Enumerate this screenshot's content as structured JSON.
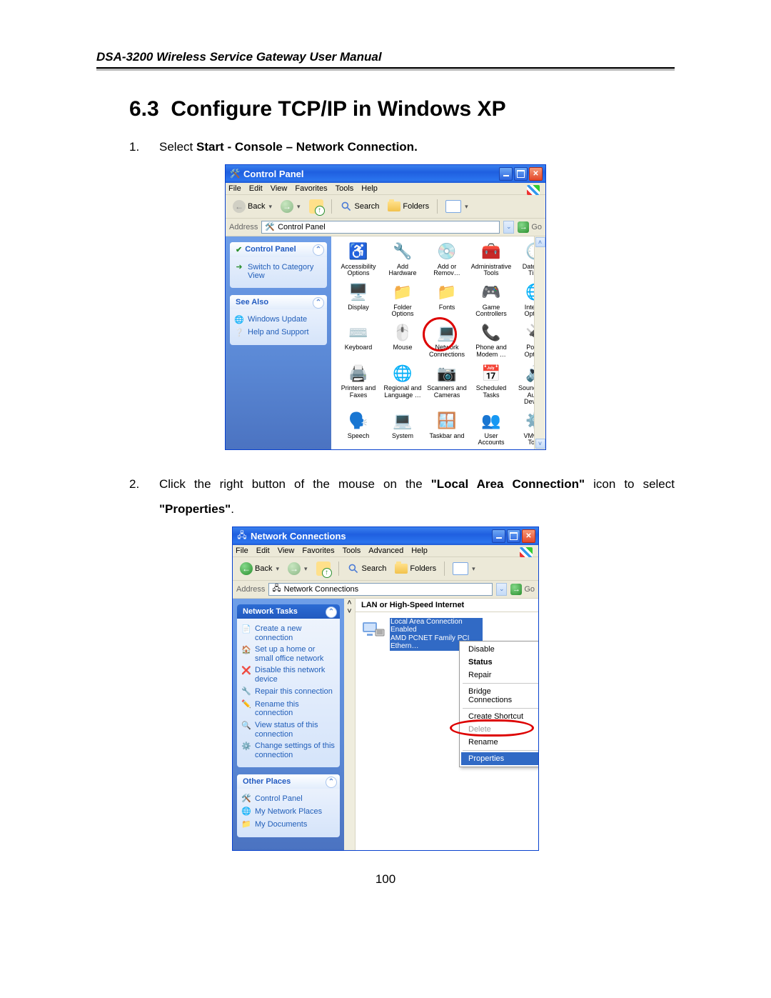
{
  "header": {
    "running_head": "DSA-3200 Wireless Service Gateway User Manual"
  },
  "section": {
    "number": "6.3",
    "title": "Configure TCP/IP in Windows XP"
  },
  "steps": {
    "s1_num": "1.",
    "s1_a": "Select ",
    "s1_b": "Start - Console – Network Connection.",
    "s2_num": "2.",
    "s2_a": "Click the right button of the mouse on the ",
    "s2_b": "\"Local Area Connection\"",
    "s2_c": " icon to select ",
    "s2_d": "\"Properties\"",
    "s2_e": "."
  },
  "win1": {
    "title": "Control Panel",
    "menus": [
      "File",
      "Edit",
      "View",
      "Favorites",
      "Tools",
      "Help"
    ],
    "back": "Back",
    "search": "Search",
    "folders": "Folders",
    "addr_label": "Address",
    "addr_value": "Control Panel",
    "go": "Go",
    "side1_head": "Control Panel",
    "side1_item": "Switch to Category View",
    "side2_head": "See Also",
    "side2_items": [
      "Windows Update",
      "Help and Support"
    ],
    "grid": [
      {
        "l": "Accessibility Options",
        "i": "♿",
        "c": "#2a8f2f"
      },
      {
        "l": "Add Hardware",
        "i": "🔧",
        "c": "#5a5a5a"
      },
      {
        "l": "Add or Remov…",
        "i": "💿",
        "c": "#4b7bd6"
      },
      {
        "l": "Administrative Tools",
        "i": "🧰",
        "c": "#caa24a"
      },
      {
        "l": "Date and Time",
        "i": "🕒",
        "c": "#4b7bd6"
      },
      {
        "l": "Display",
        "i": "🖥️",
        "c": "#4b7bd6"
      },
      {
        "l": "Folder Options",
        "i": "📁",
        "c": "#e3b84e"
      },
      {
        "l": "Fonts",
        "i": "📁",
        "c": "#e3b84e"
      },
      {
        "l": "Game Controllers",
        "i": "🎮",
        "c": "#7aa7e3"
      },
      {
        "l": "Internet Options",
        "i": "🌐",
        "c": "#4b7bd6"
      },
      {
        "l": "Keyboard",
        "i": "⌨️",
        "c": "#888"
      },
      {
        "l": "Mouse",
        "i": "🖱️",
        "c": "#888"
      },
      {
        "l": "Network Connections",
        "i": "💻",
        "c": "#4b7bd6",
        "hi": true
      },
      {
        "l": "Phone and Modem …",
        "i": "📞",
        "c": "#caa24a"
      },
      {
        "l": "Power Options",
        "i": "🔌",
        "c": "#caa24a"
      },
      {
        "l": "Printers and Faxes",
        "i": "🖨️",
        "c": "#888"
      },
      {
        "l": "Regional and Language …",
        "i": "🌐",
        "c": "#4b7bd6"
      },
      {
        "l": "Scanners and Cameras",
        "i": "📷",
        "c": "#888"
      },
      {
        "l": "Scheduled Tasks",
        "i": "📅",
        "c": "#caa24a"
      },
      {
        "l": "Sounds and Audio Devices",
        "i": "🔊",
        "c": "#888"
      },
      {
        "l": "Speech",
        "i": "🗣️",
        "c": "#4b7bd6"
      },
      {
        "l": "System",
        "i": "💻",
        "c": "#4b7bd6"
      },
      {
        "l": "Taskbar and",
        "i": "🪟",
        "c": "#4b7bd6"
      },
      {
        "l": "User Accounts",
        "i": "👥",
        "c": "#d98a3a"
      },
      {
        "l": "VMware Tools",
        "i": "⚙️",
        "c": "#888"
      }
    ]
  },
  "win2": {
    "title": "Network Connections",
    "menus": [
      "File",
      "Edit",
      "View",
      "Favorites",
      "Tools",
      "Advanced",
      "Help"
    ],
    "back": "Back",
    "search": "Search",
    "folders": "Folders",
    "addr_label": "Address",
    "addr_value": "Network Connections",
    "go": "Go",
    "side1_head": "Network Tasks",
    "side1_items": [
      "Create a new connection",
      "Set up a home or small office network",
      "Disable this network device",
      "Repair this connection",
      "Rename this connection",
      "View status of this connection",
      "Change settings of this connection"
    ],
    "side2_head": "Other Places",
    "side2_items": [
      "Control Panel",
      "My Network Places",
      "My Documents"
    ],
    "group": "LAN or High-Speed Internet",
    "lac_name": "Local Area Connection",
    "lac_status": "Enabled",
    "lac_device": "AMD PCNET Family PCI Ethern…",
    "ctx": [
      {
        "t": "Disable"
      },
      {
        "t": "Status",
        "b": true
      },
      {
        "t": "Repair"
      },
      {
        "sep": true
      },
      {
        "t": "Bridge Connections"
      },
      {
        "sep": true
      },
      {
        "t": "Create Shortcut"
      },
      {
        "t": "Delete",
        "d": true
      },
      {
        "t": "Rename"
      },
      {
        "sep": true
      },
      {
        "t": "Properties",
        "sel": true
      }
    ]
  },
  "page_number": "100"
}
